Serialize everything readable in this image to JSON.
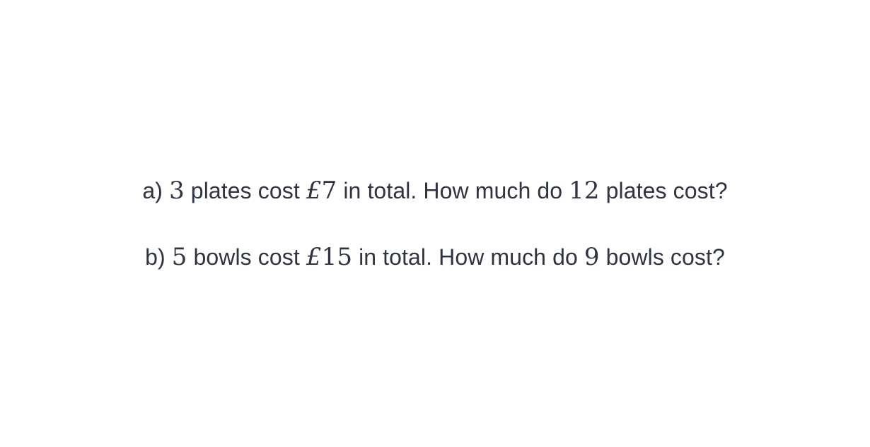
{
  "questions": [
    {
      "label": "a)",
      "quantity": "3",
      "item_text": "plates cost",
      "currency_symbol": "£",
      "price": "7",
      "middle_text": "in total. How much do",
      "target_quantity": "12",
      "end_text": "plates cost?"
    },
    {
      "label": "b)",
      "quantity": "5",
      "item_text": "bowls cost",
      "currency_symbol": "£",
      "price": "15",
      "middle_text": "in total. How much do",
      "target_quantity": "9",
      "end_text": "bowls cost?"
    }
  ]
}
